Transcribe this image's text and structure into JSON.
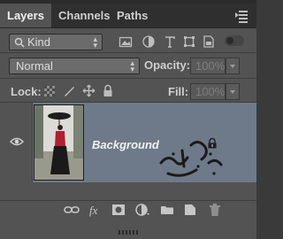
{
  "tabs": [
    {
      "label": "Layers",
      "active": true
    },
    {
      "label": "Channels",
      "active": false
    },
    {
      "label": "Paths",
      "active": false
    }
  ],
  "filter": {
    "label": "Kind"
  },
  "blend": {
    "mode": "Normal",
    "opacity_label": "Opacity:",
    "opacity_value": "100%"
  },
  "lock_row": {
    "lock_label": "Lock:",
    "fill_label": "Fill:",
    "fill_value": "100%"
  },
  "layer": {
    "name": "Background",
    "visible": true,
    "locked": true
  },
  "colors": {
    "panel": "#535353",
    "selected_layer": "#6e7a8a",
    "tabbar": "#2f2f2f"
  }
}
